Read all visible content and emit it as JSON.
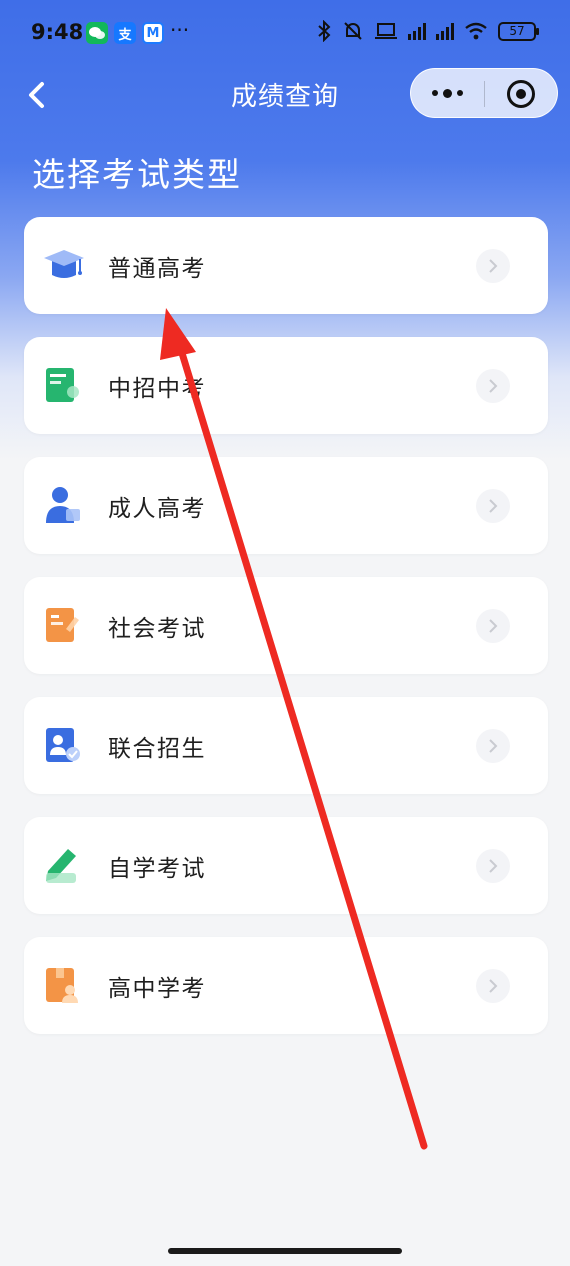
{
  "status_bar": {
    "time": "9:48",
    "more": "···",
    "battery": "57",
    "app_icons": [
      "wechat-icon",
      "alipay-icon",
      "mini-app-icon"
    ]
  },
  "nav": {
    "title": "成绩查询",
    "back_icon": "chevron-left-icon",
    "capsule_more_icon": "more-dots-icon",
    "capsule_close_icon": "target-circle-icon"
  },
  "heading": "选择考试类型",
  "exam_types": [
    {
      "label": "普通高考",
      "icon": "graduation-cap-icon",
      "color": "#4a7ef0"
    },
    {
      "label": "中招中考",
      "icon": "notebook-icon",
      "color": "#2fbf78"
    },
    {
      "label": "成人高考",
      "icon": "person-icon",
      "color": "#4a7ef0"
    },
    {
      "label": "社会考试",
      "icon": "document-pen-icon",
      "color": "#f59a4a"
    },
    {
      "label": "联合招生",
      "icon": "user-card-icon",
      "color": "#4a7ef0"
    },
    {
      "label": "自学考试",
      "icon": "pencil-icon",
      "color": "#2fbf78"
    },
    {
      "label": "高中学考",
      "icon": "book-person-icon",
      "color": "#f59a4a"
    }
  ],
  "colors": {
    "accent": "#3f6ee8",
    "annotation_arrow": "#ee2a22"
  }
}
